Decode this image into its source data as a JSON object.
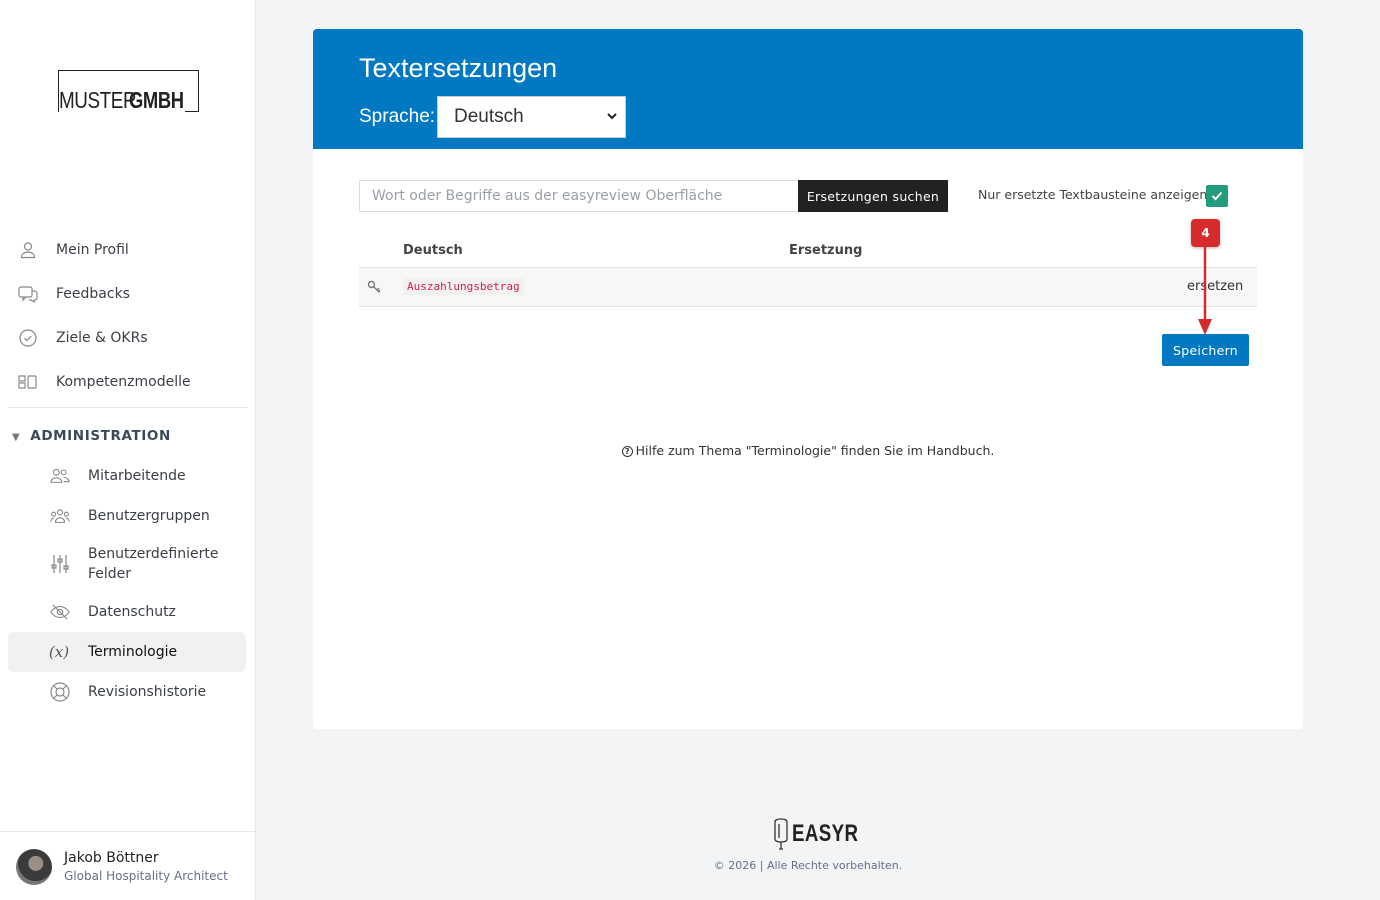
{
  "logo": {
    "part1": "MUSTER",
    "part2": "GMBH"
  },
  "nav": {
    "items": [
      {
        "label": "Mein Profil",
        "icon": "user-icon"
      },
      {
        "label": "Feedbacks",
        "icon": "chat-icon"
      },
      {
        "label": "Ziele & OKRs",
        "icon": "check-circle-icon"
      },
      {
        "label": "Kompetenzmodelle",
        "icon": "models-icon"
      }
    ],
    "admin_heading": "ADMINISTRATION",
    "admin_items": [
      {
        "label": "Mitarbeitende",
        "icon": "users-icon"
      },
      {
        "label": "Benutzergruppen",
        "icon": "groups-icon"
      },
      {
        "label": "Benutzerdefinierte Felder",
        "icon": "sliders-icon"
      },
      {
        "label": "Datenschutz",
        "icon": "eye-off-icon"
      },
      {
        "label": "Terminologie",
        "icon": "variable-icon",
        "active": true
      },
      {
        "label": "Revisionshistorie",
        "icon": "lifebuoy-icon"
      }
    ]
  },
  "user": {
    "name": "Jakob Böttner",
    "role": "Global Hospitality Architect"
  },
  "header": {
    "title": "Textersetzungen",
    "language_label": "Sprache:",
    "language_value": "Deutsch"
  },
  "search": {
    "placeholder": "Wort oder Begriffe aus der easyreview Oberfläche",
    "button_label": "Ersetzungen suchen",
    "filter_label": "Nur ersetzte Textbausteine anzeigen",
    "filter_checked": true
  },
  "table": {
    "columns": [
      "Deutsch",
      "Ersetzung"
    ],
    "rows": [
      {
        "key": "Auszahlungsbetrag",
        "replacement": "",
        "action": "ersetzen"
      }
    ]
  },
  "save_label": "Speichern",
  "help": {
    "text": "Hilfe zum Thema \"Terminologie\" finden Sie im Handbuch."
  },
  "annotation": {
    "badge": "4"
  },
  "footer": {
    "brand": "EASYR",
    "copyright": "© 2026 | Alle Rechte vorbehalten."
  },
  "colors": {
    "primary": "#0079c2",
    "check": "#239b7d",
    "annotation": "#d52b2b"
  }
}
